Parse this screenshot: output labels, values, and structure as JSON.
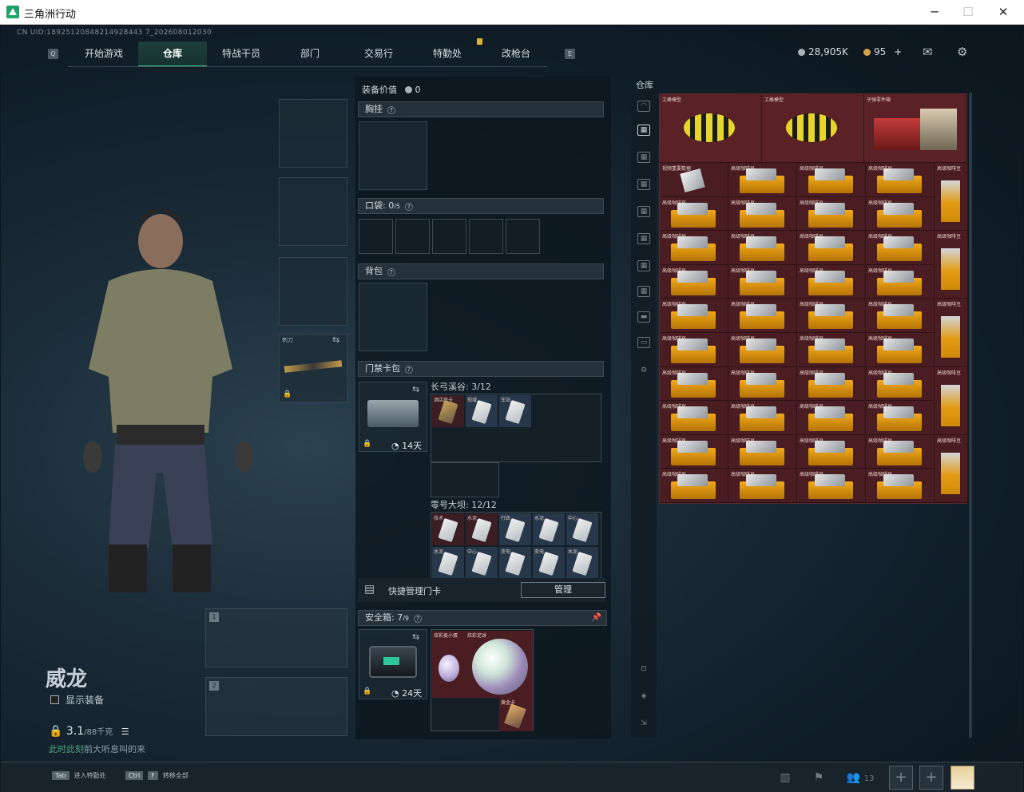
{
  "window": {
    "title": "三角洲行动"
  },
  "header": {
    "uid": "CN UID:18925120848214928443 7_202608012030",
    "tabs": [
      "开始游戏",
      "仓库",
      "特战干员",
      "部门",
      "交易行",
      "特勤处",
      "改枪台"
    ],
    "active_tab": "仓库",
    "currency_silver": "28,905K",
    "currency_gold": "95",
    "plus": "+"
  },
  "character": {
    "name": "威龙",
    "show_equipment": "显示装备",
    "weight": "3.1",
    "weight_max": "/88千克",
    "hint_green": "此时此刻",
    "hint_rest": "前大听息叫的来"
  },
  "loadout": {
    "melee_label": "刺刀",
    "weapon_slot_1": "1",
    "weapon_slot_2": "2"
  },
  "middle": {
    "equip_value_label": "装备价值",
    "equip_value": "0",
    "chest_rig": "胸挂",
    "pockets_label": "口袋:",
    "pockets_count": "0",
    "pockets_max": "/5",
    "backpack": "背包",
    "keycard_pack": "门禁卡包",
    "map1_name": "长弓溪谷:",
    "map1_count": "3/12",
    "map2_name": "零号大坝:",
    "map2_count": "12/12",
    "key_days_1": "14天",
    "map1_cards": [
      "酒店房卡",
      "视域",
      "车站"
    ],
    "map2_cards": [
      "技术",
      "水泥",
      "行政",
      "水泥",
      "中心",
      "水泥",
      "中心",
      "变电",
      "变电",
      "水泥"
    ],
    "quick_manage": "快捷管理门卡",
    "manage_btn": "管理",
    "safe_box_label": "安全箱:",
    "safe_box_count": "7",
    "safe_box_max": "/9",
    "safe_days": "24天",
    "safe_items": [
      "炫彩麦小蛋",
      "炫彩足球",
      "黄金卡"
    ]
  },
  "storage": {
    "label": "仓库",
    "big_items": [
      "工蜂模型",
      "工蜂模型",
      "子弹零件箱"
    ],
    "first_row": [
      "视频重要数据",
      "高级咖啡豆",
      "高级咖啡豆",
      "高级咖啡豆",
      "高级咖啡豆"
    ],
    "crate_name": "高级咖啡豆",
    "coffee_name": "高级咖啡豆"
  },
  "footer": {
    "tab_key": "Tab",
    "tab_label": "进入特勤处",
    "ctrl_key": "Ctrl",
    "f_key": "F",
    "ctrl_label": "转移全部",
    "friends_count": "13"
  },
  "colors": {
    "accent": "#38c39a",
    "storage_bg": "#44181c",
    "crate": "#f2a91a"
  }
}
